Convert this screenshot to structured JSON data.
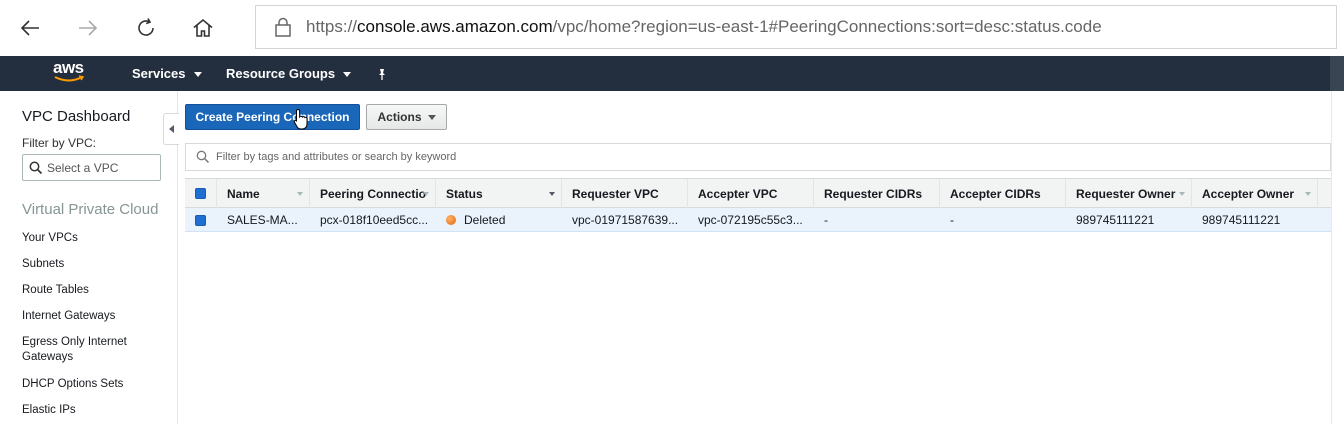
{
  "browser": {
    "url_prefix": "https://",
    "url_host": "console.aws.amazon.com",
    "url_rest": "/vpc/home?region=us-east-1#PeeringConnections:sort=desc:status.code",
    "icons": [
      "back-icon",
      "forward-icon",
      "refresh-icon",
      "home-icon",
      "lock-icon"
    ]
  },
  "aws_nav": {
    "logo": "aws",
    "services_label": "Services",
    "resource_groups_label": "Resource Groups",
    "colors": {
      "bar": "#232f3e",
      "logo_smile": "#ff9900"
    }
  },
  "sidebar": {
    "title": "VPC Dashboard",
    "filter_label": "Filter by VPC:",
    "select_placeholder": "Select a VPC",
    "section_title": "Virtual Private Cloud",
    "items": [
      {
        "label": "Your VPCs"
      },
      {
        "label": "Subnets"
      },
      {
        "label": "Route Tables"
      },
      {
        "label": "Internet Gateways"
      },
      {
        "label": "Egress Only Internet Gateways"
      },
      {
        "label": "DHCP Options Sets"
      },
      {
        "label": "Elastic IPs"
      }
    ]
  },
  "toolbar": {
    "create_label": "Create Peering Connection",
    "actions_label": "Actions",
    "primary_color": "#1a66b8"
  },
  "filter": {
    "placeholder": "Filter by tags and attributes or search by keyword"
  },
  "table": {
    "columns": [
      {
        "label": "Name"
      },
      {
        "label": "Peering Connectio"
      },
      {
        "label": "Status"
      },
      {
        "label": "Requester VPC"
      },
      {
        "label": "Accepter VPC"
      },
      {
        "label": "Requester CIDRs"
      },
      {
        "label": "Accepter CIDRs"
      },
      {
        "label": "Requester Owner"
      },
      {
        "label": "Accepter Owner"
      }
    ],
    "rows": [
      {
        "name": "SALES-MA...",
        "peering_connection": "pcx-018f10eed5cc...",
        "status": "Deleted",
        "status_color": "#e5640f",
        "requester_vpc": "vpc-01971587639...",
        "accepter_vpc": "vpc-072195c55c3...",
        "requester_cidrs": "-",
        "accepter_cidrs": "-",
        "requester_owner": "989745111221",
        "accepter_owner": "989745111221"
      }
    ]
  }
}
